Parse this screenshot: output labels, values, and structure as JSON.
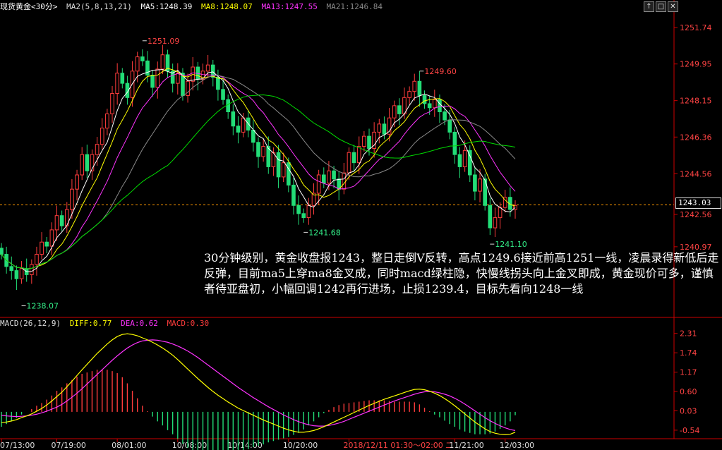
{
  "header": {
    "symbol": "现货黄金<30分>",
    "indicator": "MA2(5,8,13,21)",
    "ma5": "MA5:1248.39",
    "ma8": "MA8:1248.07",
    "ma13": "MA13:1247.55",
    "ma21": "MA21:1246.84"
  },
  "macd_header": {
    "name": "MACD(26,12,9)",
    "diff": "DIFF:0.77",
    "dea": "DEA:0.62",
    "macd": "MACD:0.30"
  },
  "controls": {
    "c1": "↑",
    "c2": "□",
    "c3": "✕"
  },
  "current_price": "1243.03",
  "annotation": "30分钟级别，黄金收盘报1243，整日走倒V反转，高点1249.6接近前高1251一线，凌晨录得新低后走反弹，目前ma5上穿ma8金叉成，同时macd绿柱隐，快慢线拐头向上金叉即成，黄金现价可多，谨慎者待亚盘初，小幅回调1242再行进场，止损1239.4，目标先看向1248一线",
  "colors": {
    "up": "#ff3c3c",
    "down": "#22dd77",
    "ma5": "#ffffff",
    "ma8": "#ffff00",
    "ma13": "#ff33ff",
    "ma21": "#00dd00",
    "axis": "#cc0000",
    "diff": "#ffff00",
    "dea": "#ff33ff"
  },
  "chart_data": [
    {
      "type": "candlestick",
      "title": "现货黄金<30分>",
      "ylim": [
        1237.5,
        1252.4
      ],
      "y_ticks": [
        1251.74,
        1249.95,
        1248.15,
        1246.36,
        1244.56,
        1242.56,
        1240.97
      ],
      "x_ticks": [
        "07/13:00",
        "07/19:00",
        "08/01:00",
        "10/08:00",
        "10/14:00",
        "10/20:00",
        "2018/12/11 01:30～02:00 二",
        "11/21:00",
        "12/03:00"
      ],
      "annotations": [
        {
          "text": "1251.09",
          "index": 28,
          "value": 1251.09
        },
        {
          "text": "1249.60",
          "index": 83,
          "value": 1249.6
        },
        {
          "text": "1241.68",
          "index": 60,
          "value": 1241.68
        },
        {
          "text": "1241.10",
          "index": 97,
          "value": 1241.1
        },
        {
          "text": "1238.07",
          "index": 4,
          "value": 1238.07
        }
      ],
      "close": [
        1240.6,
        1240.0,
        1239.8,
        1239.4,
        1239.9,
        1239.6,
        1240.1,
        1240.6,
        1241.2,
        1241.0,
        1241.8,
        1242.5,
        1242.0,
        1242.8,
        1243.8,
        1244.5,
        1245.5,
        1244.7,
        1245.5,
        1246.0,
        1246.8,
        1247.5,
        1248.5,
        1249.5,
        1249.0,
        1248.3,
        1249.6,
        1250.3,
        1250.1,
        1249.4,
        1248.8,
        1249.7,
        1250.4,
        1249.6,
        1249.0,
        1249.5,
        1248.4,
        1249.1,
        1249.8,
        1249.2,
        1249.6,
        1249.9,
        1249.3,
        1248.7,
        1248.2,
        1247.6,
        1246.9,
        1246.6,
        1247.3,
        1246.7,
        1246.1,
        1245.4,
        1245.9,
        1244.9,
        1245.6,
        1244.4,
        1245.1,
        1244.0,
        1243.0,
        1242.6,
        1242.4,
        1243.0,
        1243.6,
        1244.5,
        1244.1,
        1244.7,
        1244.3,
        1243.8,
        1244.6,
        1245.6,
        1245.1,
        1245.9,
        1246.4,
        1245.8,
        1246.6,
        1247.0,
        1246.5,
        1247.3,
        1247.9,
        1247.5,
        1248.3,
        1248.6,
        1249.1,
        1248.4,
        1248.0,
        1247.8,
        1248.2,
        1247.6,
        1247.2,
        1246.6,
        1245.5,
        1244.9,
        1245.7,
        1244.5,
        1243.7,
        1244.3,
        1243.0,
        1241.9,
        1242.4,
        1242.9,
        1243.4,
        1242.8,
        1243.0
      ],
      "series": [
        {
          "name": "MA5",
          "latest": 1248.39
        },
        {
          "name": "MA8",
          "latest": 1248.07
        },
        {
          "name": "MA13",
          "latest": 1247.55
        },
        {
          "name": "MA21",
          "latest": 1246.84
        }
      ],
      "current_price": 1243.03
    },
    {
      "type": "macd",
      "title": "MACD(26,12,9)",
      "ylim": [
        -0.75,
        2.45
      ],
      "y_ticks": [
        2.31,
        1.74,
        1.17,
        0.6,
        0.03,
        -0.54
      ],
      "diff": [
        -0.32,
        -0.3,
        -0.27,
        -0.23,
        -0.17,
        -0.12,
        -0.06,
        0.02,
        0.1,
        0.2,
        0.32,
        0.45,
        0.58,
        0.74,
        0.9,
        1.07,
        1.24,
        1.4,
        1.56,
        1.72,
        1.86,
        2.0,
        2.12,
        2.22,
        2.28,
        2.3,
        2.28,
        2.24,
        2.18,
        2.12,
        2.05,
        1.97,
        1.88,
        1.78,
        1.67,
        1.54,
        1.4,
        1.26,
        1.12,
        0.98,
        0.85,
        0.72,
        0.6,
        0.49,
        0.39,
        0.29,
        0.2,
        0.11,
        0.04,
        -0.03,
        -0.1,
        -0.17,
        -0.24,
        -0.3,
        -0.36,
        -0.42,
        -0.48,
        -0.53,
        -0.57,
        -0.6,
        -0.6,
        -0.58,
        -0.55,
        -0.5,
        -0.44,
        -0.37,
        -0.3,
        -0.23,
        -0.16,
        -0.09,
        -0.02,
        0.05,
        0.12,
        0.19,
        0.25,
        0.31,
        0.37,
        0.42,
        0.47,
        0.52,
        0.57,
        0.62,
        0.66,
        0.67,
        0.65,
        0.61,
        0.55,
        0.48,
        0.39,
        0.29,
        0.18,
        0.06,
        -0.06,
        -0.18,
        -0.3,
        -0.4,
        -0.5,
        -0.58,
        -0.63,
        -0.66,
        -0.67,
        -0.66,
        -0.6
      ],
      "dea": [
        -0.1,
        -0.12,
        -0.13,
        -0.14,
        -0.13,
        -0.12,
        -0.1,
        -0.07,
        -0.03,
        0.02,
        0.08,
        0.14,
        0.22,
        0.32,
        0.43,
        0.55,
        0.68,
        0.82,
        0.96,
        1.1,
        1.24,
        1.38,
        1.52,
        1.65,
        1.77,
        1.88,
        1.97,
        2.04,
        2.09,
        2.11,
        2.12,
        2.11,
        2.08,
        2.05,
        2.0,
        1.94,
        1.87,
        1.79,
        1.7,
        1.6,
        1.49,
        1.38,
        1.27,
        1.16,
        1.05,
        0.94,
        0.83,
        0.72,
        0.62,
        0.52,
        0.42,
        0.33,
        0.24,
        0.15,
        0.07,
        -0.01,
        -0.09,
        -0.16,
        -0.23,
        -0.29,
        -0.34,
        -0.38,
        -0.41,
        -0.42,
        -0.42,
        -0.4,
        -0.37,
        -0.33,
        -0.28,
        -0.22,
        -0.16,
        -0.1,
        -0.04,
        0.02,
        0.08,
        0.14,
        0.2,
        0.26,
        0.32,
        0.37,
        0.42,
        0.47,
        0.52,
        0.56,
        0.59,
        0.6,
        0.59,
        0.56,
        0.52,
        0.47,
        0.4,
        0.32,
        0.23,
        0.13,
        0.03,
        -0.07,
        -0.17,
        -0.26,
        -0.34,
        -0.41,
        -0.47,
        -0.52,
        -0.55
      ],
      "series": [
        {
          "name": "DIFF",
          "latest": 0.77
        },
        {
          "name": "DEA",
          "latest": 0.62
        },
        {
          "name": "MACD",
          "latest": 0.3
        }
      ]
    }
  ]
}
